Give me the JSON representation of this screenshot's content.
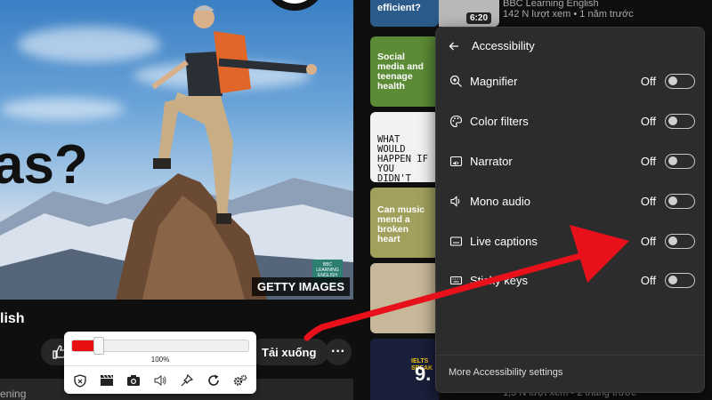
{
  "video": {
    "overlay_text": "as?",
    "watermark": "GETTY IMAGES",
    "badge": "BBC LEARNING ENGLISH"
  },
  "below_video": {
    "title_fragment": "lish",
    "download_label": "Tải xuống",
    "more_label": "···",
    "description_fragment": "ening"
  },
  "zoom_widget": {
    "percent_label": "100%",
    "level": 0.1,
    "tools": [
      "shield-icon",
      "clapper-icon",
      "camera-icon",
      "speaker-icon",
      "pin-icon",
      "refresh-icon",
      "gears-icon"
    ]
  },
  "recommended": {
    "top_item": {
      "thumb_text": "efficient?",
      "duration": "6:20",
      "channel": "BBC Learning English",
      "meta": "142 N lượt xem • 1 năm trước"
    },
    "thumbs": [
      {
        "text": "Social media and teenage health",
        "bg": "#5c8b36"
      },
      {
        "text": "WHAT WOULD HAPPEN IF YOU DIDN'T DRINK",
        "bg": "#f2f2f2"
      },
      {
        "text": "Can music mend a broken heart",
        "bg": "#a1a05d"
      },
      {
        "text": "",
        "bg": "#c8b89a"
      },
      {
        "text": "",
        "bg": "#1a1f3a"
      }
    ],
    "bottom_duration": "9.",
    "bottom_meta": "1,3 N lượt xem • 2 tháng trước",
    "bottom_badge": "IELTS SPEAK"
  },
  "accessibility": {
    "title": "Accessibility",
    "rows": [
      {
        "label": "Magnifier",
        "state": "Off",
        "icon": "magnifier-icon"
      },
      {
        "label": "Color filters",
        "state": "Off",
        "icon": "palette-icon"
      },
      {
        "label": "Narrator",
        "state": "Off",
        "icon": "narrator-icon"
      },
      {
        "label": "Mono audio",
        "state": "Off",
        "icon": "speaker-icon"
      },
      {
        "label": "Live captions",
        "state": "Off",
        "icon": "captions-icon"
      },
      {
        "label": "Sticky keys",
        "state": "Off",
        "icon": "keyboard-icon"
      }
    ],
    "footer": "More Accessibility settings"
  },
  "colors": {
    "arrow": "#e8101a",
    "flyout_bg": "#2c2c2c",
    "zoom_fill": "#e81010"
  }
}
